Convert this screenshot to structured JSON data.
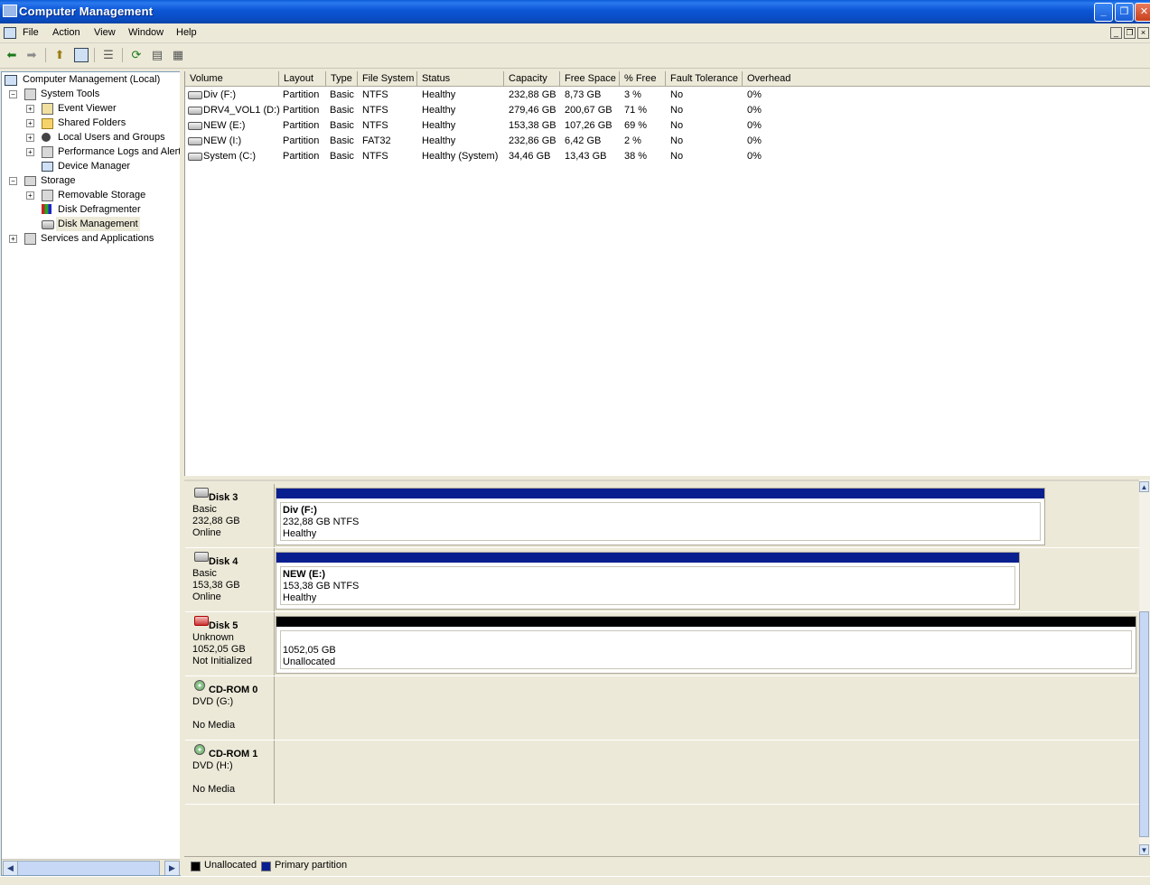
{
  "window": {
    "title": "Computer Management"
  },
  "menu": {
    "items": [
      "File",
      "Action",
      "View",
      "Window",
      "Help"
    ]
  },
  "tree": {
    "root": "Computer Management (Local)",
    "system_tools": "System Tools",
    "event_viewer": "Event Viewer",
    "shared_folders": "Shared Folders",
    "local_users": "Local Users and Groups",
    "perf_logs": "Performance Logs and Alerts",
    "device_manager": "Device Manager",
    "storage": "Storage",
    "removable_storage": "Removable Storage",
    "disk_defrag": "Disk Defragmenter",
    "disk_mgmt": "Disk Management",
    "services_apps": "Services and Applications"
  },
  "volumes": {
    "headers": [
      "Volume",
      "Layout",
      "Type",
      "File System",
      "Status",
      "Capacity",
      "Free Space",
      "% Free",
      "Fault Tolerance",
      "Overhead"
    ],
    "rows": [
      [
        "Div (F:)",
        "Partition",
        "Basic",
        "NTFS",
        "Healthy",
        "232,88 GB",
        "8,73 GB",
        "3 %",
        "No",
        "0%"
      ],
      [
        "DRV4_VOL1 (D:)",
        "Partition",
        "Basic",
        "NTFS",
        "Healthy",
        "279,46 GB",
        "200,67 GB",
        "71 %",
        "No",
        "0%"
      ],
      [
        "NEW (E:)",
        "Partition",
        "Basic",
        "NTFS",
        "Healthy",
        "153,38 GB",
        "107,26 GB",
        "69 %",
        "No",
        "0%"
      ],
      [
        "NEW (I:)",
        "Partition",
        "Basic",
        "FAT32",
        "Healthy",
        "232,86 GB",
        "6,42 GB",
        "2 %",
        "No",
        "0%"
      ],
      [
        "System (C:)",
        "Partition",
        "Basic",
        "NTFS",
        "Healthy (System)",
        "34,46 GB",
        "13,43 GB",
        "38 %",
        "No",
        "0%"
      ]
    ]
  },
  "disks": {
    "d3": {
      "name": "Disk 3",
      "type": "Basic",
      "size": "232,88 GB",
      "status": "Online",
      "part_name": "Div  (F:)",
      "part_size": "232,88 GB NTFS",
      "part_status": "Healthy"
    },
    "d4": {
      "name": "Disk 4",
      "type": "Basic",
      "size": "153,38 GB",
      "status": "Online",
      "part_name": "NEW  (E:)",
      "part_size": "153,38 GB NTFS",
      "part_status": "Healthy"
    },
    "d5": {
      "name": "Disk 5",
      "type": "Unknown",
      "size": "1052,05 GB",
      "status": "Not Initialized",
      "part_size": "1052,05 GB",
      "part_status": "Unallocated"
    },
    "cd0": {
      "name": "CD-ROM 0",
      "drive": "DVD (G:)",
      "status": "No Media"
    },
    "cd1": {
      "name": "CD-ROM 1",
      "drive": "DVD (H:)",
      "status": "No Media"
    }
  },
  "legend": {
    "unallocated": "Unallocated",
    "primary": "Primary partition"
  },
  "colors": {
    "primary_partition": "#0a1f8f",
    "unallocated": "#000000",
    "title_bar": "#0a5bd6"
  }
}
